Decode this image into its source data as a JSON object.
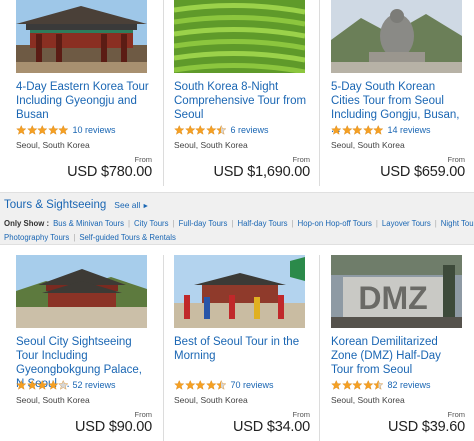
{
  "top_cards": [
    {
      "title": "4-Day Eastern Korea Tour Including Gyeongju and Busan",
      "rating": 5,
      "reviews": "10 reviews",
      "location": "Seoul, South Korea",
      "from_label": "From",
      "price": "USD $780.00",
      "image": "temple-gate"
    },
    {
      "title": "South Korea 8-Night Comprehensive Tour from Seoul",
      "rating": 4.5,
      "reviews": "6 reviews",
      "location": "Seoul, South Korea",
      "from_label": "From",
      "price": "USD $1,690.00",
      "image": "tea-fields"
    },
    {
      "title": "5-Day South Korean Cities Tour from Seoul Including Gongju, Busan, ...",
      "rating": 5,
      "reviews": "14 reviews",
      "location": "Seoul, South Korea",
      "from_label": "From",
      "price": "USD $659.00",
      "image": "buddha-statue"
    }
  ],
  "category": {
    "title": "Tours & Sightseeing",
    "see_all": "See all",
    "only_show": "Only Show :",
    "filters_line1": [
      "Bus & Minivan Tours",
      "City Tours",
      "Full-day Tours",
      "Half-day Tours",
      "Hop-on Hop-off Tours",
      "Layover Tours",
      "Night Tours"
    ],
    "filters_line2": [
      "Photography Tours",
      "Self-guided Tours & Rentals"
    ]
  },
  "bottom_cards": [
    {
      "title": "Seoul City Sightseeing Tour Including Gyeongbokgung Palace, N Seoul ...",
      "rating": 4,
      "reviews": "52 reviews",
      "location": "Seoul, South Korea",
      "from_label": "From",
      "price": "USD $90.00",
      "image": "palace"
    },
    {
      "title": "Best of Seoul Tour in the Morning",
      "rating": 4.5,
      "reviews": "70 reviews",
      "location": "Seoul, South Korea",
      "from_label": "From",
      "price": "USD $34.00",
      "image": "guard-ceremony"
    },
    {
      "title": "Korean Demilitarized Zone (DMZ) Half-Day Tour from Seoul",
      "rating": 4.5,
      "reviews": "82 reviews",
      "location": "Seoul, South Korea",
      "from_label": "From",
      "price": "USD $39.60",
      "image": "dmz-sign"
    }
  ],
  "colors": {
    "link": "#1a66b3",
    "star_fill": "#f5a023",
    "band_bg": "#f0f0f0"
  }
}
